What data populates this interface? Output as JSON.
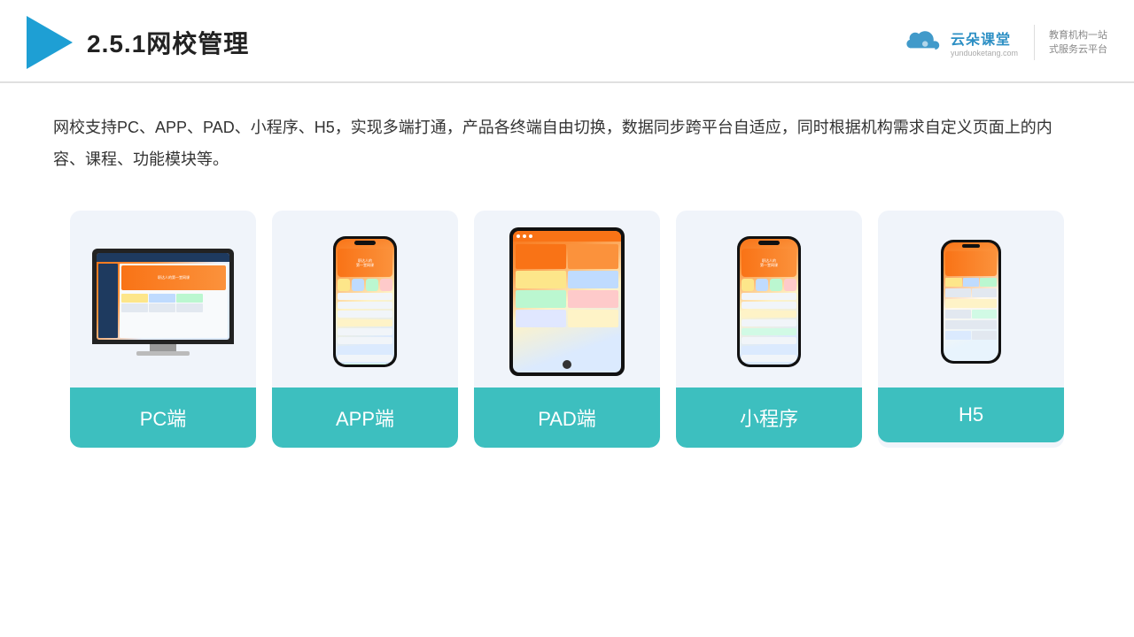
{
  "header": {
    "title": "2.5.1网校管理",
    "brand": {
      "name": "云朵课堂",
      "url": "yunduoketang.com",
      "slogan": "教育机构一站\n式服务云平台"
    }
  },
  "description": {
    "text": "网校支持PC、APP、PAD、小程序、H5，实现多端打通，产品各终端自由切换，数据同步跨平台自适应，同时根据机构需求自定义页面上的内容、课程、功能模块等。"
  },
  "cards": [
    {
      "id": "pc",
      "label": "PC端"
    },
    {
      "id": "app",
      "label": "APP端"
    },
    {
      "id": "pad",
      "label": "PAD端"
    },
    {
      "id": "mini",
      "label": "小程序"
    },
    {
      "id": "h5",
      "label": "H5"
    }
  ]
}
